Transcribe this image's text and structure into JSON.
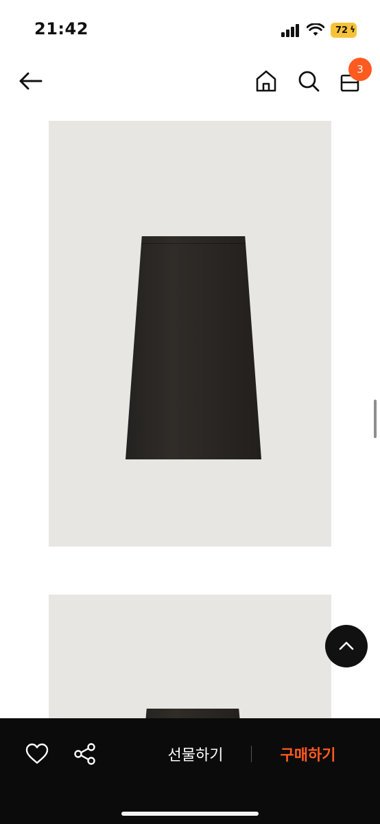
{
  "status_bar": {
    "time": "21:42",
    "battery_level": "72",
    "battery_color": "#f6c338",
    "icons": [
      "signal-icon",
      "wifi-icon",
      "battery-icon"
    ]
  },
  "header": {
    "icons": [
      "back-arrow-icon",
      "home-icon",
      "search-icon",
      "shopping-bag-icon"
    ],
    "cart_count": "3",
    "badge_color": "#ff5a1f"
  },
  "gallery": {
    "images": [
      {
        "subject": "black-pencil-skirt-front"
      },
      {
        "subject": "black-pencil-skirt-back"
      }
    ]
  },
  "floating": {
    "scroll_top_icon": "chevron-up-icon"
  },
  "bottom_bar": {
    "like_icon": "heart-icon",
    "share_icon": "share-icon",
    "gift_label": "선물하기",
    "buy_label": "구매하기",
    "buy_color": "#ff5a1f",
    "background": "#0b0b0b"
  }
}
